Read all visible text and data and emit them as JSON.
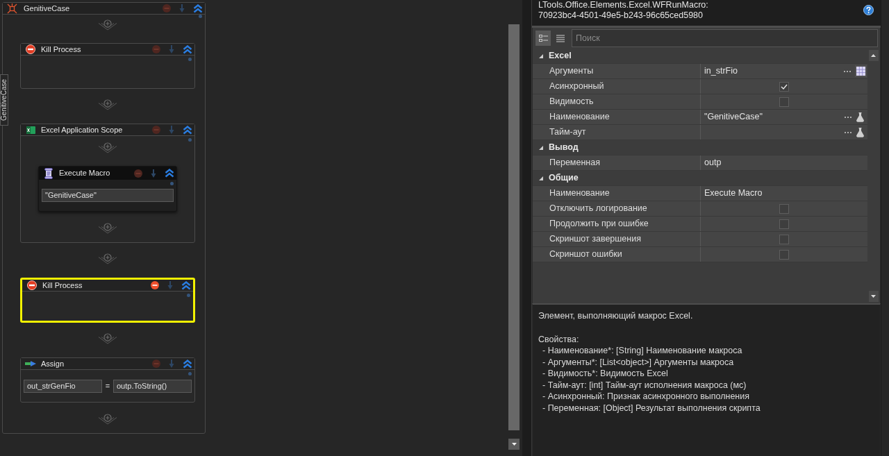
{
  "designer": {
    "side_tab": "GenitiveCase",
    "sequence": {
      "title": "GenitiveCase",
      "activities": [
        {
          "kind": "kill_process",
          "title": "Kill Process",
          "selected": false
        },
        {
          "kind": "scope",
          "title": "Excel Application Scope",
          "selected": false,
          "children": [
            {
              "kind": "macro",
              "title": "Execute Macro",
              "selected": false,
              "value": "\"GenitiveCase\""
            }
          ]
        },
        {
          "kind": "kill_process",
          "title": "Kill Process",
          "selected": true
        },
        {
          "kind": "assign",
          "title": "Assign",
          "selected": false,
          "target": "out_strGenFio",
          "operator": "=",
          "value": "outp.ToString()"
        }
      ]
    }
  },
  "properties": {
    "title_lines": [
      "LTools.Office.Elements.Excel.WFRunMacro:",
      "70923bc4-4501-49e5-b243-96c65ced5980"
    ],
    "toolbar": {
      "view_modes": [
        {
          "kind": "categorized",
          "selected": true
        },
        {
          "kind": "alphabetical",
          "selected": false
        }
      ],
      "search": {
        "placeholder": "Поиск"
      }
    },
    "categories": [
      {
        "name": "Excel",
        "expanded": true,
        "rows": [
          {
            "name": "Аргументы",
            "kind": "text",
            "value": "in_strFio",
            "editor": {
              "kind": "grid"
            }
          },
          {
            "name": "Асинхронный",
            "kind": "checkbox",
            "checked": true
          },
          {
            "name": "Видимость",
            "kind": "checkbox",
            "checked": false
          },
          {
            "name": "Наименование",
            "kind": "text",
            "value": "\"GenitiveCase\"",
            "editor": {
              "kind": "expression"
            }
          },
          {
            "name": "Тайм-аут",
            "kind": "text",
            "editor": {
              "kind": "expression"
            }
          }
        ]
      },
      {
        "name": "Вывод",
        "expanded": true,
        "rows": [
          {
            "name": "Переменная",
            "kind": "text",
            "value": "outp"
          }
        ]
      },
      {
        "name": "Общие",
        "expanded": true,
        "rows": [
          {
            "name": "Наименование",
            "kind": "text",
            "value": "Execute Macro"
          },
          {
            "name": "Отключить логирование",
            "kind": "checkbox",
            "checked": false
          },
          {
            "name": "Продолжить при ошибке",
            "kind": "checkbox",
            "checked": false
          },
          {
            "name": "Скриншот завершения",
            "kind": "checkbox",
            "checked": false
          },
          {
            "name": "Скриншот ошибки",
            "kind": "checkbox",
            "checked": false
          }
        ]
      }
    ]
  },
  "description": {
    "summary": "Элемент, выполняющий макрос Excel.",
    "heading": "Свойства:",
    "items": [
      "- Наименование*: [String] Наименование макроса",
      "- Аргументы*: [List<object>] Аргументы макроса",
      "- Видимость*: Видимость Excel",
      "- Тайм-аут: [int] Тайм-аут исполнения макроса (мс)",
      "- Асинхронный: Признак асинхронного выполнения",
      "- Переменная: [Object] Результат выполнения скрипта"
    ]
  }
}
